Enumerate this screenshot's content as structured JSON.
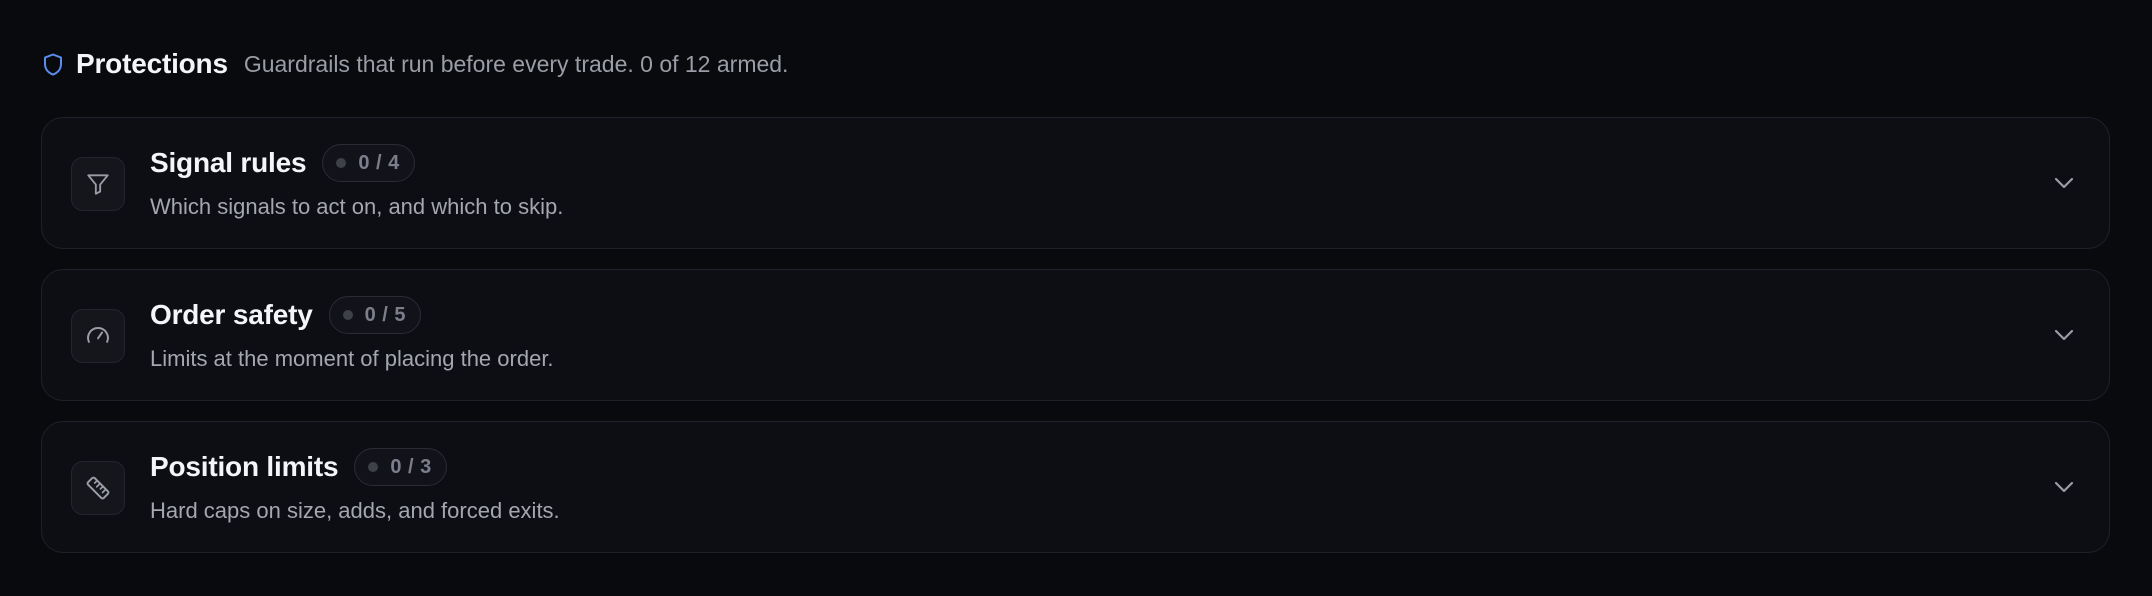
{
  "header": {
    "icon": "shield-icon",
    "title": "Protections",
    "subtitle": "Guardrails that run before every trade. 0 of 12 armed."
  },
  "colors": {
    "accent": "#5b8def",
    "background": "#090a0e",
    "card_background": "#0d0e13",
    "border": "#1f2129"
  },
  "sections": [
    {
      "icon": "filter-icon",
      "title": "Signal rules",
      "badge": "0 / 4",
      "description": "Which signals to act on, and which to skip."
    },
    {
      "icon": "gauge-icon",
      "title": "Order safety",
      "badge": "0 / 5",
      "description": "Limits at the moment of placing the order."
    },
    {
      "icon": "ruler-icon",
      "title": "Position limits",
      "badge": "0 / 3",
      "description": "Hard caps on size, adds, and forced exits."
    }
  ]
}
